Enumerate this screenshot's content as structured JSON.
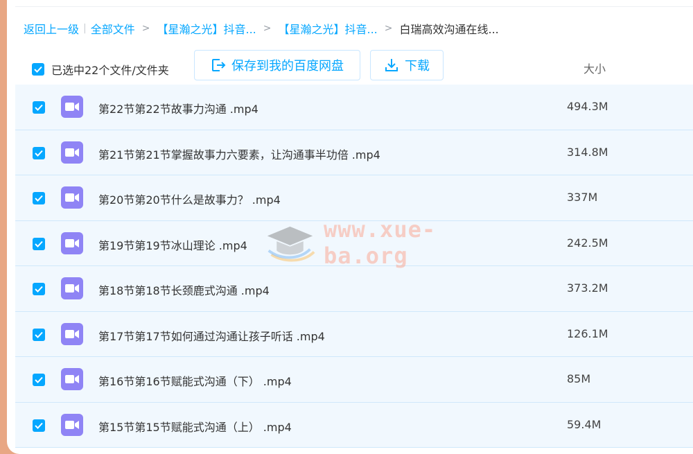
{
  "breadcrumb": {
    "back": "返回上一级",
    "all_files": "全部文件",
    "level1": "【星瀚之光】抖音...",
    "level2": "【星瀚之光】抖音...",
    "current": "白瑞高效沟通在线...",
    "separator": ">",
    "pipe": "|"
  },
  "toolbar": {
    "selection_label": "已选中22个文件/文件夹",
    "save_button": "保存到我的百度网盘",
    "download_button": "下载",
    "size_column": "大小"
  },
  "watermark": {
    "text": "www.xue-ba.org"
  },
  "files": [
    {
      "name": "第22节第22节故事力沟通 .mp4",
      "size": "494.3M"
    },
    {
      "name": "第21节第21节掌握故事力六要素，让沟通事半功倍 .mp4",
      "size": "314.8M"
    },
    {
      "name": "第20节第20节什么是故事力？ .mp4",
      "size": "337M"
    },
    {
      "name": "第19节第19节冰山理论 .mp4",
      "size": "242.5M"
    },
    {
      "name": "第18节第18节长颈鹿式沟通 .mp4",
      "size": "373.2M"
    },
    {
      "name": "第17节第17节如何通过沟通让孩子听话 .mp4",
      "size": "126.1M"
    },
    {
      "name": "第16节第16节赋能式沟通（下） .mp4",
      "size": "85M"
    },
    {
      "name": "第15节第15节赋能式沟通（上） .mp4",
      "size": "59.4M"
    }
  ],
  "colors": {
    "accent": "#06a7ff",
    "video_icon": "#8f84f5",
    "row_bg": "#f1f8fe"
  },
  "icons": {
    "checkbox": "check-icon",
    "file": "video-icon",
    "save": "save-to-cloud-icon",
    "download": "download-icon",
    "watermark": "graduation-cap-icon"
  }
}
